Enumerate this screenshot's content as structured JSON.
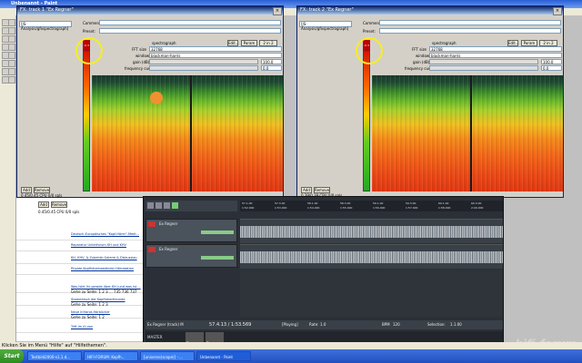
{
  "paint": {
    "title": "Unbenannt - Paint",
    "status": "Klicken Sie im Menü \"Hilfe\" auf \"Hilfethemen\"."
  },
  "taskbar": {
    "start": "Start",
    "tasks": [
      "Testbild2000-v1.1.d...",
      "HIFI-FORUM: Kopfh...",
      "[universe(scope)] - ...",
      "Unbenannt - Paint"
    ]
  },
  "plugin_left": {
    "title": "FX: track 1 \"Ex Regner\"",
    "fx_item": "[JS: Analysis/gfxspectrograph]",
    "comment_label": "Comment",
    "preset_label": "Preset:",
    "edit": "Edit...",
    "param": "Param",
    "io": "2 in 2 out",
    "section": "spectrograph",
    "fft_label": "FFT size",
    "fft_value": "32768",
    "window_label": "window",
    "window_value": "blackman-harris",
    "gain_label": "gain (dB)",
    "gain_value": "100.0",
    "freq_label": "frequency curve",
    "freq_value": "0.0",
    "meter_value": "-0.3",
    "add": "Add",
    "remove": "Remove",
    "cpu": "0.45/0.45 CPU 0/0 spls"
  },
  "plugin_right": {
    "title": "FX: track 2 \"Ex Regner\"",
    "fx_item": "[JS: Analysis/gfxspectrograph]",
    "comment_label": "Comment",
    "preset_label": "Preset:",
    "edit": "Edit...",
    "param": "Param",
    "io": "2 in 2 out",
    "section": "spectrograph",
    "fft_label": "FFT size",
    "fft_value": "32768",
    "window_label": "window",
    "window_value": "blackman-harris",
    "gain_label": "gain (dB)",
    "gain_value": "100.0",
    "freq_label": "frequency curve",
    "freq_value": "0.0",
    "meter_value": "-0.3",
    "add": "Add",
    "remove": "Remove",
    "cpu": "0.39/0.39 CPU 0/0 spls"
  },
  "web": {
    "add": "Add",
    "remove": "Remove",
    "cpu": "0.45/0.45 CPU 0/0 spls",
    "rows": [
      "Deutsch-Europäisches \"Kopf-Hörer\"-Meet...",
      "Reparatur Unterforum KH und KHV",
      "KH, KHV, & Zubehör-Galerie & Diskussion",
      "Private Kopfhörerbestände/-Hörrotation",
      "Was hört ihr gerade über KH (und was ist ...",
      "Stammtisch der Kopfhörerfreunde",
      "Neue Infrarot-Hörbücher",
      "Trift im AI von"
    ],
    "pages": [
      "Gehe zu Seite: 1 2 3 ... 735 736 737",
      "Gehe zu Seite: 1 2 3",
      "Gehe zu Seite: 1 2"
    ]
  },
  "reaper": {
    "track1_name": "Ex Regner",
    "track2_name": "Ex Regner",
    "ruler_marks": [
      "57.1.00",
      "57.3.00",
      "58.1.00",
      "58.3.00",
      "59.1.00",
      "59.3.00",
      "60.1.00",
      "60.3.00"
    ],
    "ruler_times": [
      "1:52.000",
      "1:53.000",
      "1:54.000",
      "1:55.000",
      "1:56.000",
      "1:57.000",
      "1:58.000",
      "2:00.000"
    ],
    "transport_time": "57.4.13 / 1:53.569",
    "status": "[Playing]",
    "rate_label": "Rate:",
    "rate_value": "1.0",
    "bpm_label": "BPM",
    "bpm_value": "120",
    "selection_label": "Selection:",
    "selection_value": "1.1.00",
    "master_label": "MASTER",
    "mixer_tracks": [
      "Ex Regner",
      "Ex Regner"
    ],
    "bottom_label": "Ex Regner (track) M"
  },
  "watermark": "hifi-forum"
}
